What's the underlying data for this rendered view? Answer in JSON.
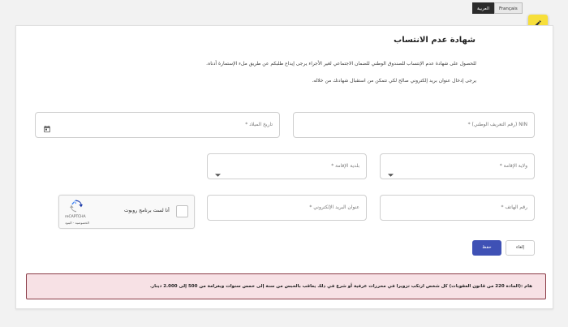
{
  "lang": {
    "arabic": "العربية",
    "french": "Français"
  },
  "form": {
    "title": "شهادة عدم الانتساب",
    "desc1": "للحصول على شهادة عدم الإنتساب للصندوق الوطني للضمان الاجتماعي لغير الأجراء يرجى إيداع طلبكم عن طريق ملء الإستمارة أدناه.",
    "desc2": "يرجى إدخال عنوان بريد إلكتروني صالح لكي تتمكن من استقبال شهادتك من خلاله.",
    "nin_label": "NIN (رقم التعريف الوطني) *",
    "birth_label": "تاريخ الميلاد *",
    "wilaya_label": "ولاية الإقامة *",
    "commune_label": "بلدية الإقامة *",
    "phone_label": "رقم الهاتف *",
    "email_label": "عنوان البريد الإلكتروني *"
  },
  "captcha": {
    "robot_text": "أنا لست برنامج روبوت",
    "brand": "reCAPTCHA",
    "links": "الخصوصية - البنود"
  },
  "buttons": {
    "save": "حفظ",
    "cancel": "إلغاء"
  },
  "alert": {
    "text": "هام :(المادة 220 من قانون العقوبات) كل شخص ارتكب تزويرا في محررات عرفية أو شرع في ذلك يعاقب بالحبس من سنة إلى خمس سنوات وبغرامة من 500 إلى 2.000 دينار."
  },
  "colors": {
    "primary": "#3f51b5",
    "fab": "#f7df3a",
    "alert_bg": "#f7e1e5",
    "alert_border": "#8a3b46"
  }
}
